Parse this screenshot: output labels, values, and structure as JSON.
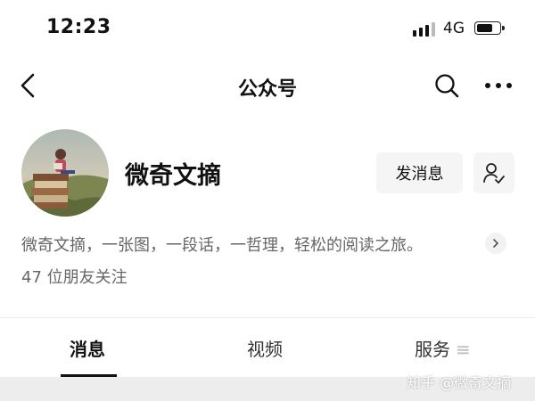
{
  "status_bar": {
    "time": "12:23",
    "network": "4G",
    "battery_level": 0.75,
    "icons": [
      "signal-icon",
      "battery-icon"
    ]
  },
  "nav": {
    "title": "公众号",
    "icons": [
      "back-chevron-icon",
      "search-icon",
      "more-dots-icon"
    ]
  },
  "profile": {
    "name": "微奇文摘",
    "message_button_label": "发消息",
    "follow_icon": "followed-user-icon",
    "description": "微奇文摘，一张图，一段话，一哲理，轻松的阅读之旅。",
    "followers": "47 位朋友关注"
  },
  "tabs": [
    {
      "label": "消息",
      "active": true
    },
    {
      "label": "视频",
      "active": false
    },
    {
      "label": "服务",
      "active": false
    }
  ],
  "watermark": "知乎 @微奇文摘",
  "colors": {
    "secondary_text": "#666666",
    "button_bg": "#f5f5f5",
    "strip_bg": "#ededed"
  }
}
